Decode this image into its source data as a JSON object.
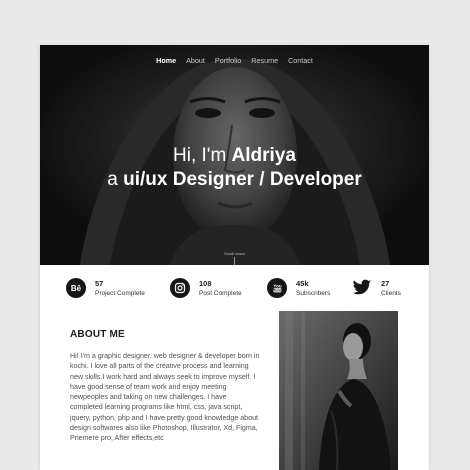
{
  "nav": {
    "items": [
      {
        "label": "Home",
        "active": true
      },
      {
        "label": "About"
      },
      {
        "label": "Portfolio"
      },
      {
        "label": "Resume"
      },
      {
        "label": "Contact"
      }
    ]
  },
  "hero": {
    "greeting": "Hi, I'm ",
    "name": "Aldriya",
    "article": "a ",
    "role": "ui/ux Designer / Developer",
    "scroll_text": "Scroll down"
  },
  "stats": [
    {
      "icon": "behance-icon",
      "value": "57",
      "label": "Project Complete"
    },
    {
      "icon": "instagram-icon",
      "value": "108",
      "label": "Post Complete"
    },
    {
      "icon": "youtube-icon",
      "value": "45k",
      "label": "Subscribers"
    },
    {
      "icon": "twitter-icon",
      "value": "27",
      "label": "Clients"
    }
  ],
  "about": {
    "title": "ABOUT ME",
    "text": "Hi! I'm a graphic designer, web designer & developer born in kochi. I love all parts of the creative process and learning new skills.I work hard and always seek to improve myself. I have good sense of team work and enjoy meeting newpeoples and taking on new challenges. I have completed learning programs like html, css, java script, jquery, python, php and I have pretty good knowledge about design softwares also like Photoshop, Illustrator, Xd, Figma, Priemere pro, After effects,etc"
  },
  "colors": {
    "page_bg": "#e9e9e9",
    "hero_bg": "#1c1c1c",
    "icon_bg": "#161616",
    "text_dark": "#1c1c1c",
    "text_body": "#505050"
  }
}
